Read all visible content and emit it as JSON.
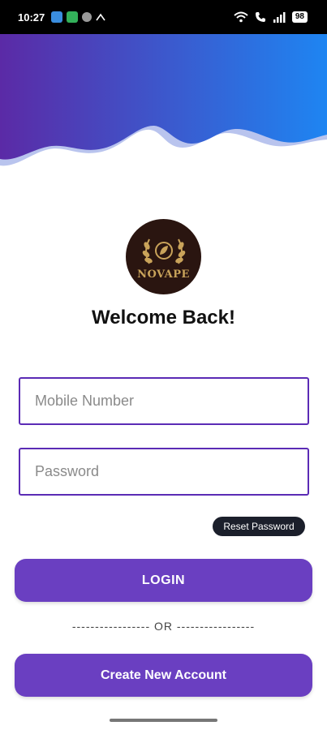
{
  "status_bar": {
    "time": "10:27",
    "battery": "98",
    "icons": [
      "notification-blue-icon",
      "notification-green-icon",
      "notification-grey-icon",
      "data-icon",
      "wifi-icon",
      "call-icon",
      "signal-icon"
    ]
  },
  "header": {
    "gradient_start": "#5b2aa6",
    "gradient_end": "#1e85f2"
  },
  "logo": {
    "brand": "NOVAPE"
  },
  "welcome_text": "Welcome Back!",
  "form": {
    "mobile_placeholder": "Mobile Number",
    "password_placeholder": "Password",
    "reset_label": "Reset Password",
    "login_label": "LOGIN",
    "divider_text": "----------------- OR -----------------",
    "create_label": "Create New Account"
  },
  "colors": {
    "accent": "#6a3fc1",
    "field_border": "#5b2bb5",
    "reset_bg": "#1b1f2b"
  }
}
